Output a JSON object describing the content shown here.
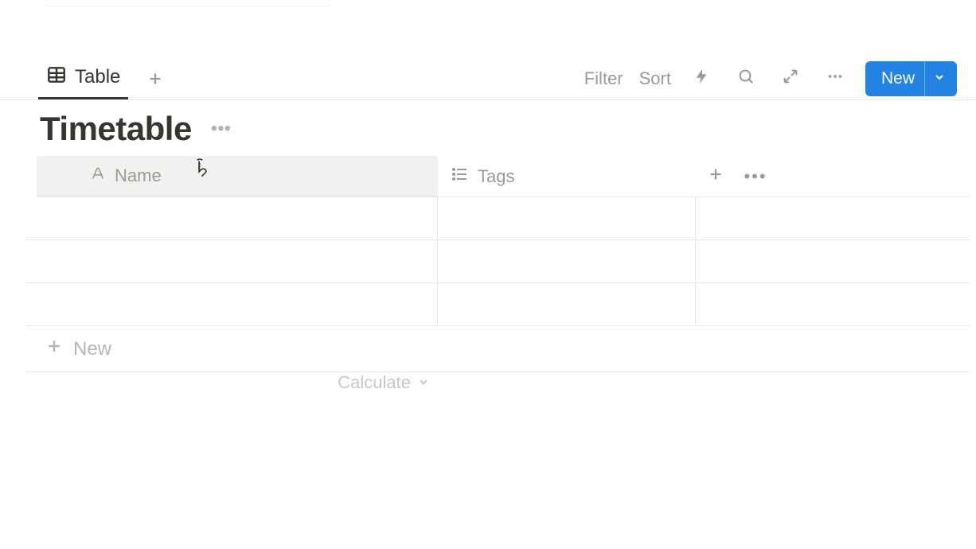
{
  "views": {
    "active_tab_label": "Table"
  },
  "toolbar": {
    "filter_label": "Filter",
    "sort_label": "Sort",
    "new_label": "New"
  },
  "database": {
    "title": "Timetable"
  },
  "columns": {
    "name_label": "Name",
    "tags_label": "Tags"
  },
  "rows": [
    {
      "name": "",
      "tags": ""
    },
    {
      "name": "",
      "tags": ""
    },
    {
      "name": "",
      "tags": ""
    }
  ],
  "footer": {
    "new_row_label": "New",
    "calculate_label": "Calculate"
  }
}
